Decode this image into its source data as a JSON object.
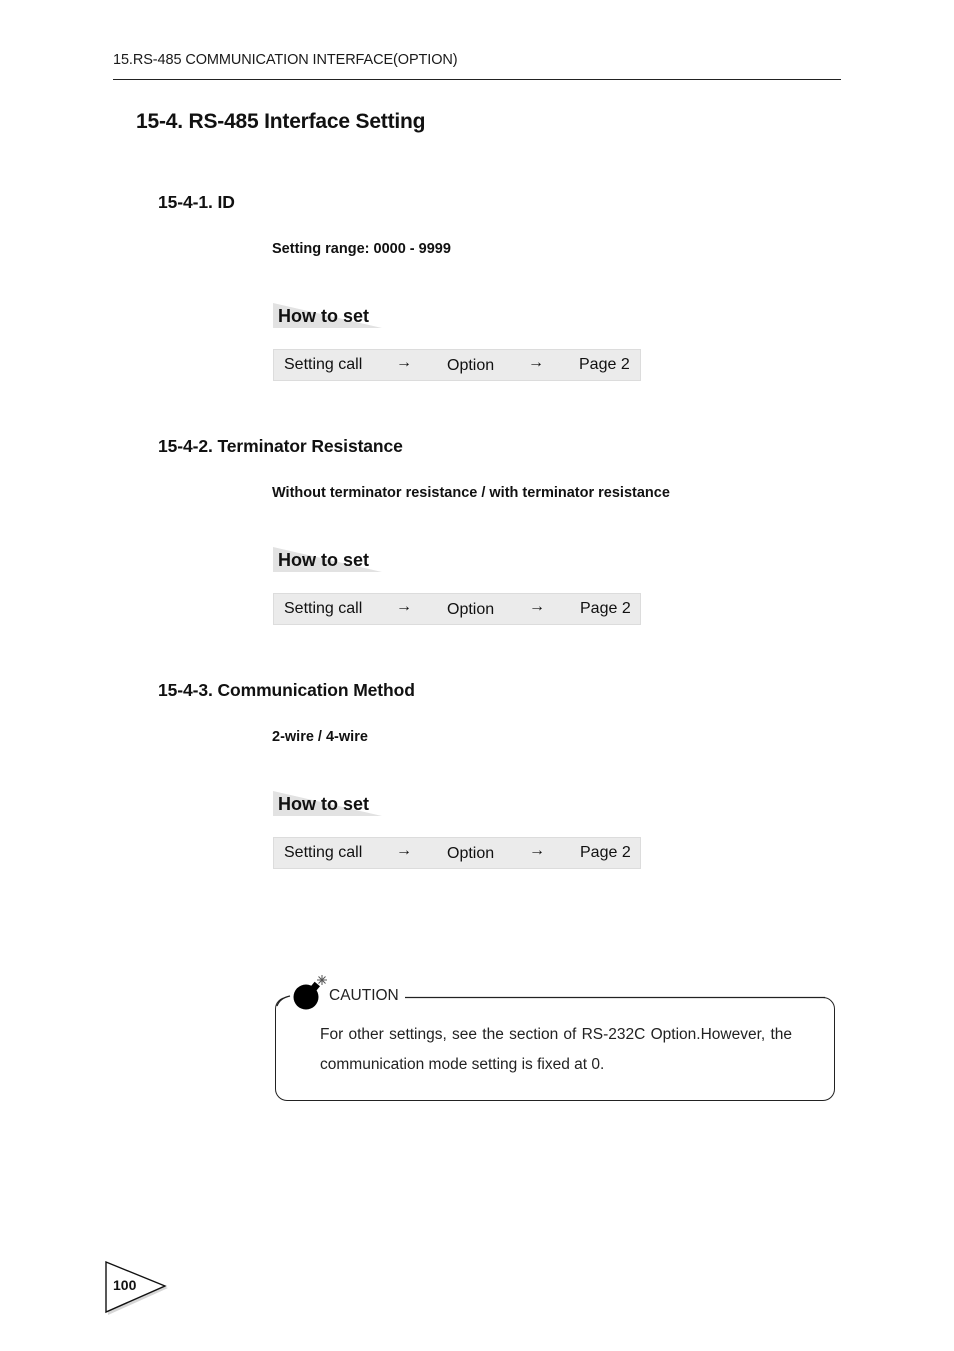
{
  "running_header": "15.RS-485 COMMUNICATION INTERFACE(OPTION)",
  "section_title": "15-4. RS-485 Interface Setting",
  "subsections": [
    {
      "title": "15-4-1. ID",
      "description": "Setting range: 0000 - 9999",
      "how_to_label": "How to set",
      "path": [
        "Setting call",
        "→",
        "Option",
        "→",
        "Page 2"
      ]
    },
    {
      "title": "15-4-2. Terminator Resistance",
      "description": "Without terminator resistance / with terminator resistance",
      "how_to_label": "How to set",
      "path": [
        "Setting call",
        "→",
        "Option",
        "→",
        "Page 2"
      ]
    },
    {
      "title": "15-4-3. Communication Method",
      "description": "2-wire / 4-wire",
      "how_to_label": "How to set",
      "path": [
        "Setting call",
        "→",
        "Option",
        "→",
        "Page 2"
      ]
    }
  ],
  "caution": {
    "icon": "bomb-icon",
    "label": "CAUTION",
    "text": "For other settings, see the section of RS-232C Option.However, the communication mode setting is fixed at 0."
  },
  "page_number": "100",
  "colors": {
    "path_box_bg": "#ebebeb",
    "howto_bg": "#e2e2e2"
  }
}
